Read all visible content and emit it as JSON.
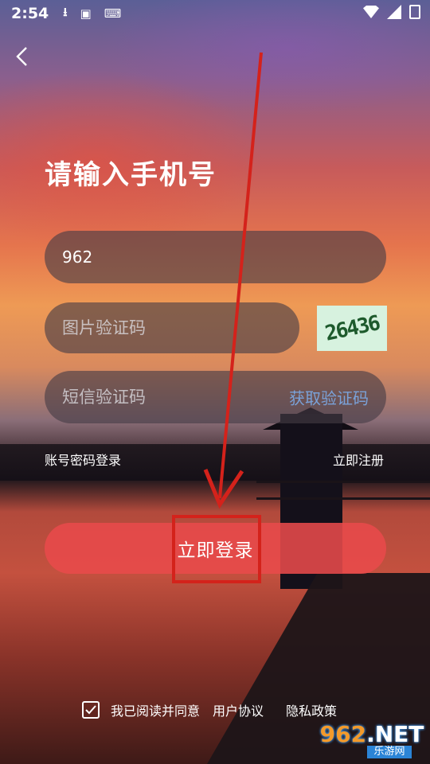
{
  "status_bar": {
    "time": "2:54",
    "icons": [
      "download-icon",
      "a-keyboard-icon",
      "keyboard-icon",
      "wifi-icon",
      "signal-icon",
      "battery-icon"
    ]
  },
  "header": {
    "back_icon": "chevron-left-icon"
  },
  "title": "请输入手机号",
  "form": {
    "phone_value": "962",
    "captcha_placeholder": "图片验证码",
    "captcha_image_text": "26436",
    "sms_placeholder": "短信验证码",
    "sms_button": "获取验证码"
  },
  "links": {
    "password_login": "账号密码登录",
    "register": "立即注册"
  },
  "login_button": "立即登录",
  "agreement": {
    "checked": true,
    "text": "我已阅读并同意",
    "user_agreement": "用户协议",
    "privacy_policy": "隐私政策"
  },
  "watermark": {
    "logo_num": "962",
    "logo_suffix": ".NET",
    "sub": "乐游网"
  },
  "colors": {
    "login_button": "#e84a4b",
    "sms_link": "#7aa2d9",
    "annotation": "#d4221b",
    "captcha_bg": "#d7f2df"
  }
}
